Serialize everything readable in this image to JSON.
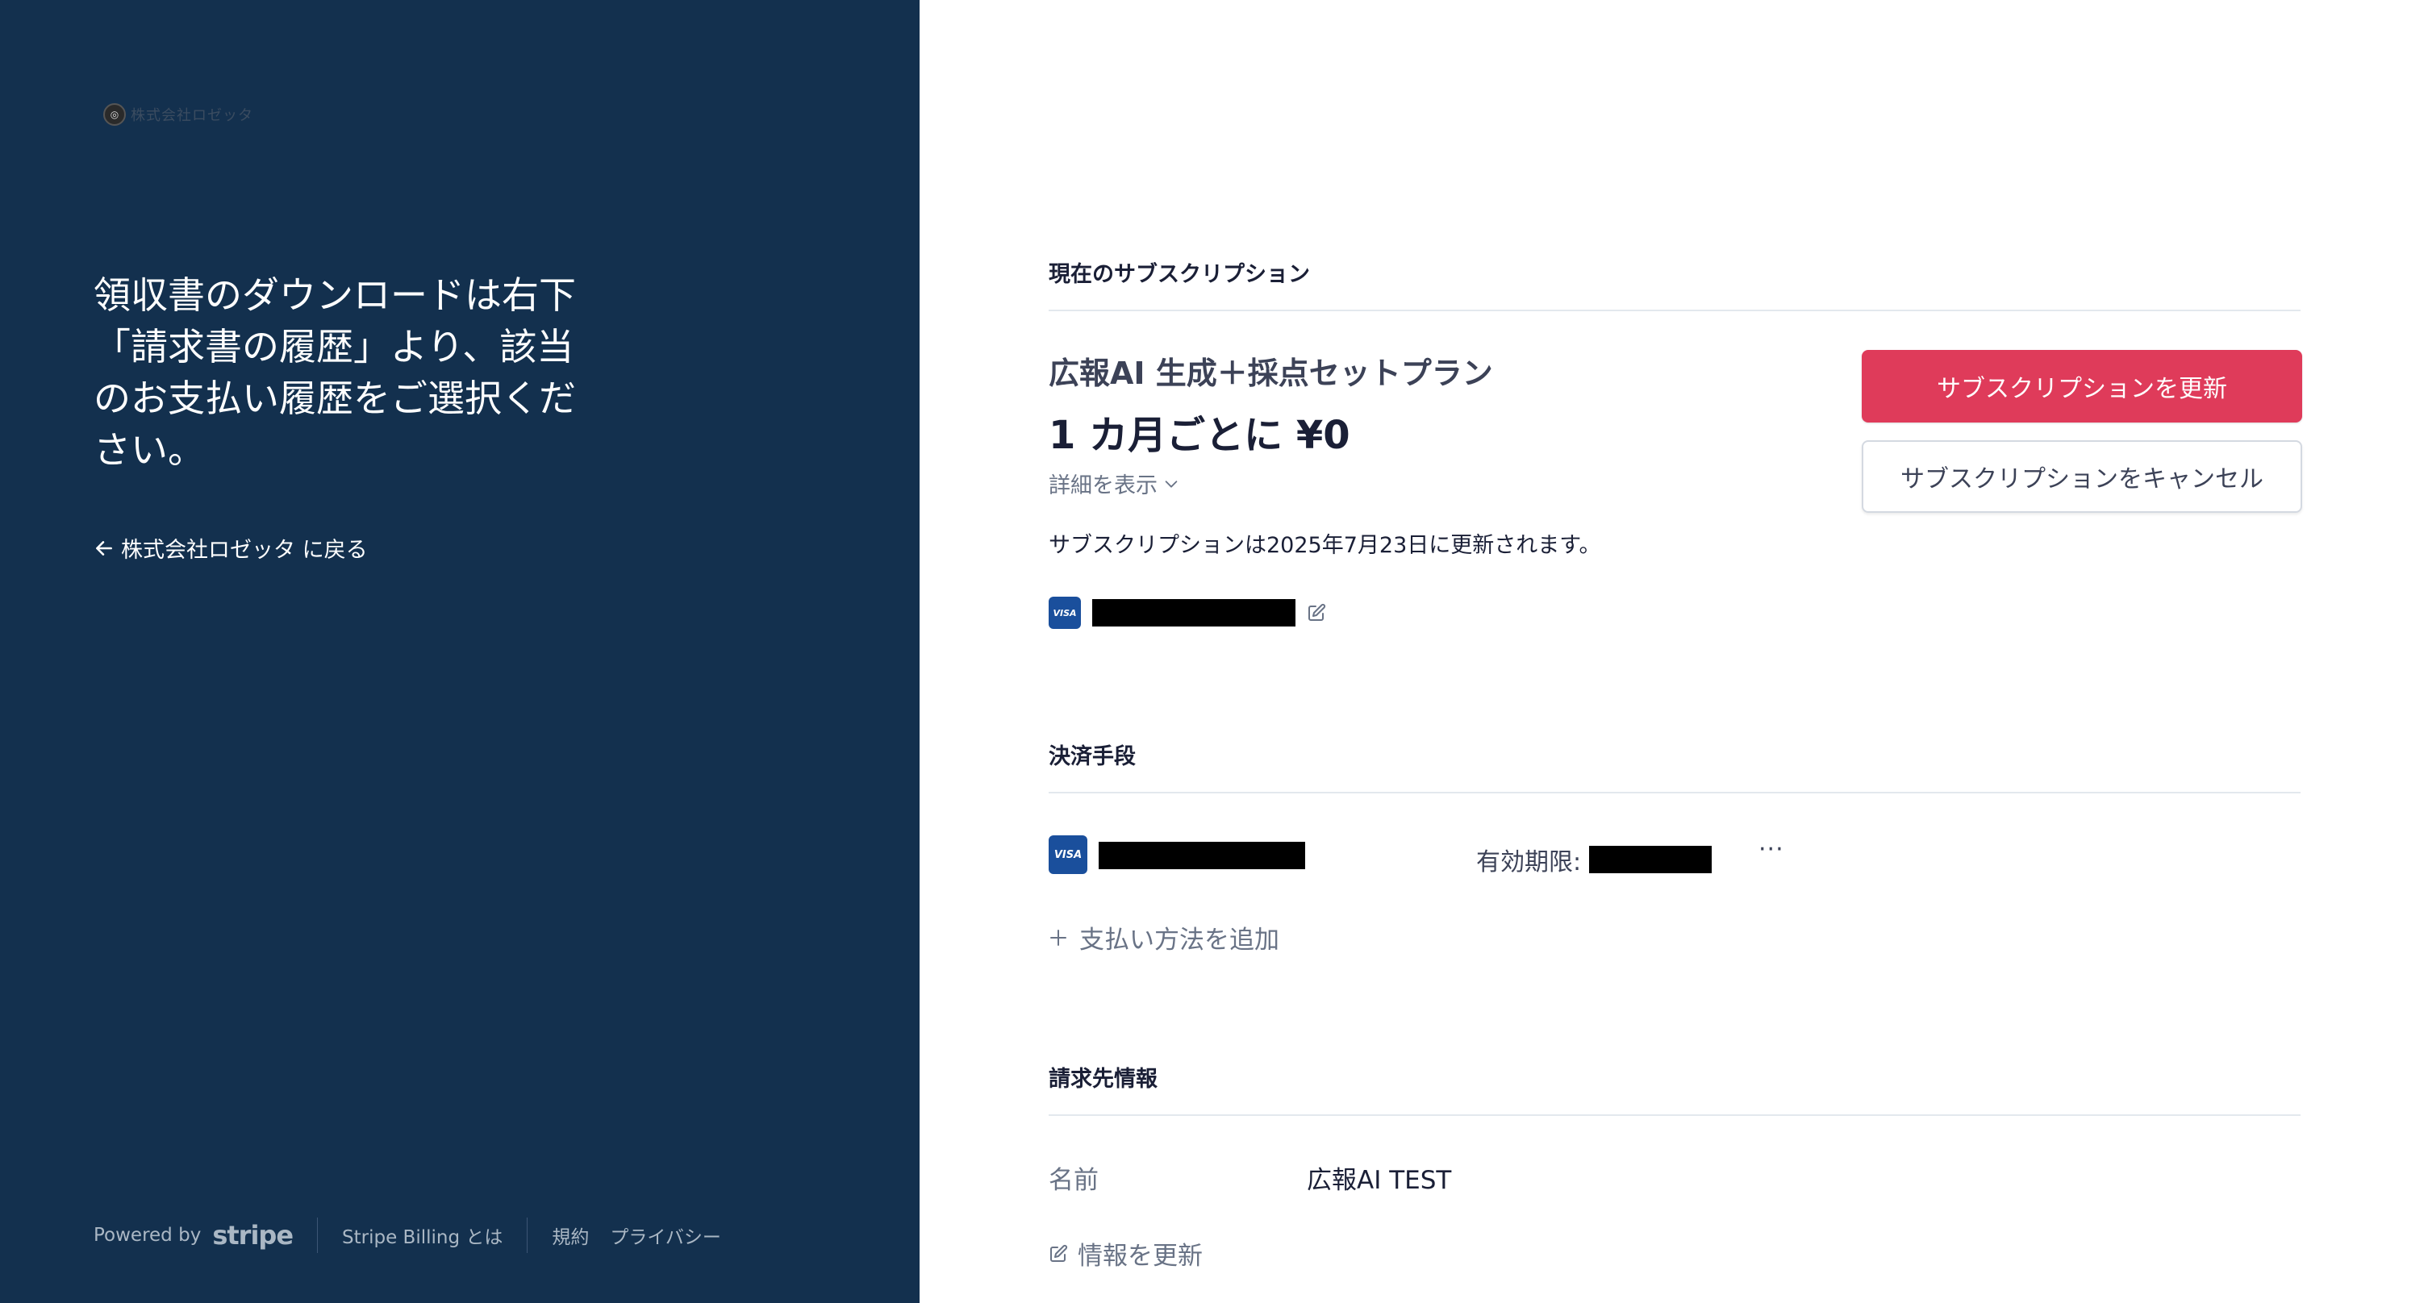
{
  "brand": {
    "logo_icon": "company-logo-icon",
    "name": "株式会社ロゼッタ"
  },
  "left": {
    "headline": "領収書のダウンロードは右下「請求書の履歴」より、該当のお支払い履歴をご選択ください。",
    "back_link": "株式会社ロゼッタ に戻る",
    "footer": {
      "powered_by": "Powered by",
      "stripe": "stripe",
      "billing_link": "Stripe Billing とは",
      "terms": "規約",
      "privacy": "プライバシー"
    }
  },
  "subscription": {
    "section_title": "現在のサブスクリプション",
    "plan_name": "広報AI 生成＋採点セットプラン",
    "price": "1 カ月ごとに ¥0",
    "details_toggle": "詳細を表示",
    "renewal_text": "サブスクリプションは2025年7月23日に更新されます。",
    "card_brand": "VISA",
    "update_button": "サブスクリプションを更新",
    "cancel_button": "サブスクリプションをキャンセル"
  },
  "payment": {
    "section_title": "決済手段",
    "card_brand": "VISA",
    "expiry_label": "有効期限:",
    "more": "···",
    "add_method": "支払い方法を追加"
  },
  "billing": {
    "section_title": "請求先情報",
    "name_label": "名前",
    "name_value": "広報AI TEST",
    "update_info": "情報を更新"
  },
  "colors": {
    "left_bg": "#13304e",
    "accent": "#df3b5a",
    "visa_blue": "#1a4f9c"
  }
}
